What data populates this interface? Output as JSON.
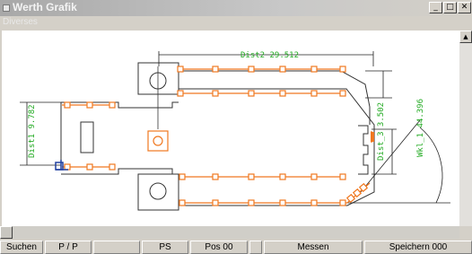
{
  "window": {
    "title": "Werth Grafik",
    "controls": {
      "minimize": "_",
      "maximize": "□",
      "close": "✕"
    }
  },
  "menu": {
    "items": [
      "Diverses"
    ]
  },
  "graphics": {
    "dimensions": [
      {
        "label": "Dist2 29.512"
      },
      {
        "label": "Dist1 9.782"
      },
      {
        "label": "Dist_3 3.502"
      },
      {
        "label": "Wkl_1 44.396"
      }
    ]
  },
  "scrollbar": {
    "up_arrow": "▲"
  },
  "statusbar": {
    "buttons": [
      "Suchen",
      "P / P",
      "",
      "PS",
      "Pos 00",
      "",
      "Messen",
      "Speichern 000"
    ]
  },
  "colors": {
    "measure_points": "#f07820",
    "dimension_text": "#22aa22",
    "geometry": "#333333"
  }
}
